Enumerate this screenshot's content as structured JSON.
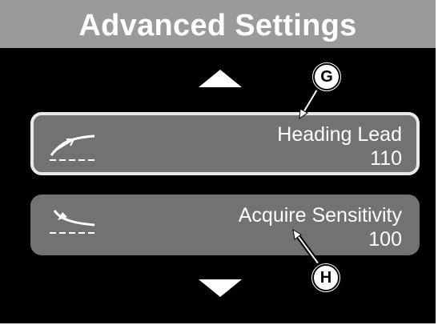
{
  "header": {
    "title": "Advanced Settings"
  },
  "navigation": {
    "up_icon": "up-triangle-arrow",
    "down_icon": "down-triangle-arrow"
  },
  "settings": [
    {
      "label": "Heading Lead",
      "value": "110",
      "icon": "heading-lead-icon",
      "selected": true
    },
    {
      "label": "Acquire Sensitivity",
      "value": "100",
      "icon": "acquire-sensitivity-icon",
      "selected": false
    }
  ],
  "callouts": [
    {
      "letter": "G"
    },
    {
      "letter": "H"
    }
  ],
  "colors": {
    "title_bar": "#9a9a9a",
    "screen_background": "#000000",
    "item_background": "#727272",
    "selected_border": "#e9e9e9",
    "text": "#ffffff"
  }
}
